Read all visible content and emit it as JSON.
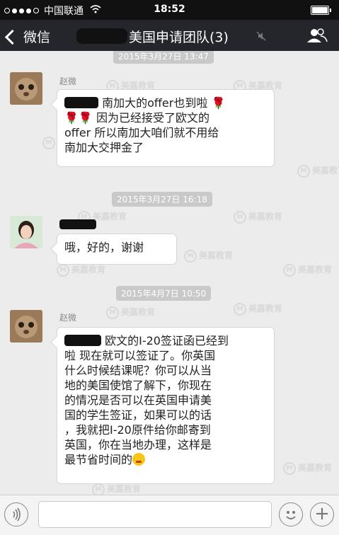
{
  "status_bar": {
    "carrier": "中国联通",
    "time": "18:52"
  },
  "nav": {
    "back_label": "微信",
    "title": "美国申请团队(3)"
  },
  "watermark": {
    "text": "美嘉教育",
    "mark": "M"
  },
  "messages": [
    {
      "timestamp": "2015年3月27日 13:47",
      "sender": "赵微",
      "lines": [
        "南加大的offer也到啦",
        "因为已经接受了欧文的",
        "offer 所以南加大咱们就不用给",
        "南加大交押金了"
      ]
    },
    {
      "timestamp": "2015年3月27日 16:18",
      "sender": "",
      "lines": [
        "哦，好的，谢谢"
      ]
    },
    {
      "timestamp": "2015年4月7日 10:50",
      "sender": "赵微",
      "lines": [
        "欧文的I-20签证函已经到",
        "啦 现在就可以签证了。你英国",
        "什么时候结课呢？你可以从当",
        "地的美国使馆了解下，你现在",
        "的情况是否可以在英国申请美",
        "国的学生签证，如果可以的话",
        "，我就把I-20原件给你邮寄到",
        "英国，你在当地办理，这样是",
        "最节省时间的"
      ]
    }
  ],
  "colors": {
    "nav_bg": "#24262b",
    "chat_bg": "#ececec",
    "bubble_bg": "#ffffff",
    "timestamp_bg": "#c9c9c9"
  },
  "icons": [
    "back-chevron-icon",
    "mute-icon",
    "group-info-icon",
    "voice-icon",
    "emoji-icon",
    "plus-icon",
    "rose-icon",
    "grin-emoji-icon"
  ]
}
